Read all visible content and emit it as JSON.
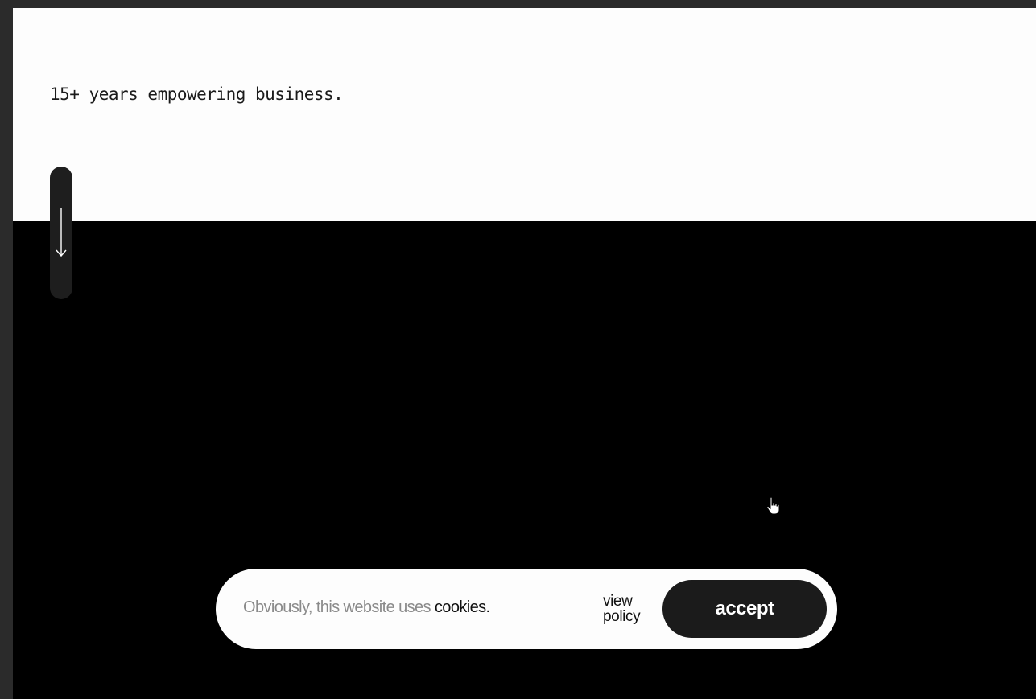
{
  "hero": {
    "tagline": "15+ years empowering business."
  },
  "scroll_indicator": {
    "icon": "arrow-down-icon"
  },
  "cookie_banner": {
    "message_prefix": "Obviously, this website uses",
    "message_highlight": "cookies.",
    "view_policy_line1": "view",
    "view_policy_line2": "policy",
    "accept_label": "accept"
  },
  "colors": {
    "background": "#000000",
    "hero_background": "#fdfdfd",
    "banner_background": "#fdfdfd",
    "accent_button": "#1b1b1b",
    "muted_text": "#8a8a8a"
  }
}
